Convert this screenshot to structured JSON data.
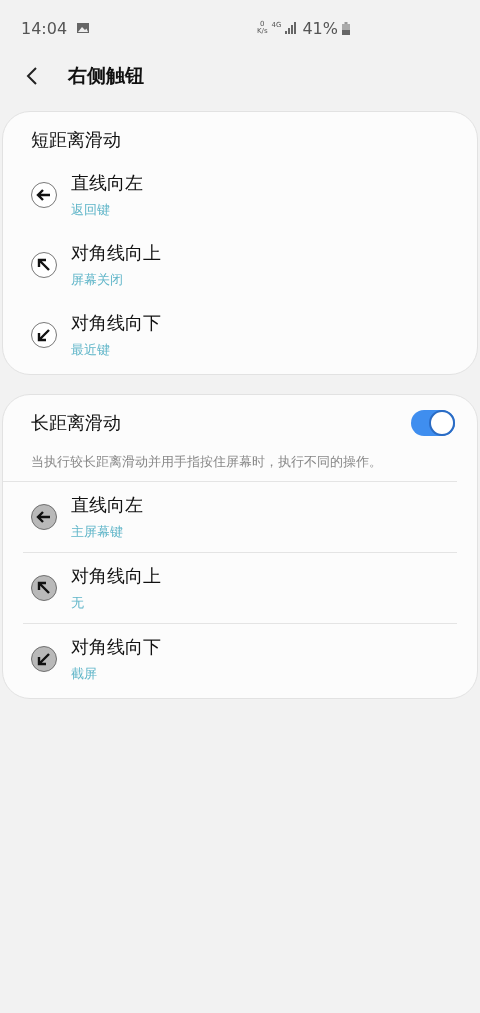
{
  "status_bar": {
    "time": "14:04",
    "net_speed": "0",
    "net_unit": "K/s",
    "network": "4G",
    "battery": "41%"
  },
  "header": {
    "title": "右侧触钮"
  },
  "sections": [
    {
      "kind": "plain",
      "title": "短距离滑动",
      "items": [
        {
          "kind": "left",
          "title": "直线向左",
          "value": "返回键"
        },
        {
          "kind": "up_left",
          "title": "对角线向上",
          "value": "屏幕关闭"
        },
        {
          "kind": "down_left",
          "title": "对角线向下",
          "value": "最近键"
        }
      ]
    },
    {
      "kind": "switch",
      "title": "长距离滑动",
      "on": true,
      "description": "当执行较长距离滑动并用手指按住屏幕时，执行不同的操作。",
      "items": [
        {
          "kind": "left",
          "title": "直线向左",
          "value": "主屏幕键"
        },
        {
          "kind": "up_left",
          "title": "对角线向上",
          "value": "无"
        },
        {
          "kind": "down_left",
          "title": "对角线向下",
          "value": "截屏"
        }
      ]
    }
  ]
}
